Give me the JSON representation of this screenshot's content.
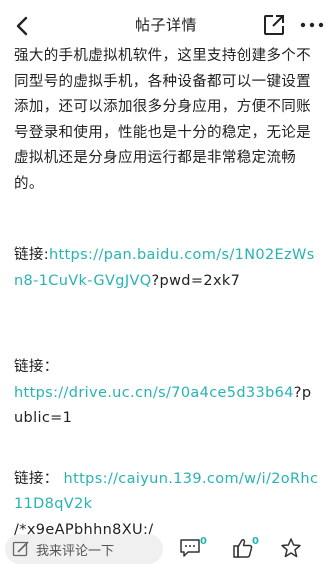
{
  "header": {
    "title": "帖子详情"
  },
  "post": {
    "body": "强大的手机虚拟机软件，这里支持创建多个不同型号的虚拟手机，各种设备都可以一键设置添加，还可以添加很多分身应用，方便不同账号登录和使用，性能也是十分的稳定，无论是虚拟机还是分身应用运行都是非常稳定流畅的。",
    "links": [
      {
        "prefix": "链接:",
        "url": "https://pan.baidu.com/s/1N02EzWsn8-1CuVk-GVgJVQ",
        "suffix": "?pwd=2xk7"
      },
      {
        "prefix": "链接：",
        "url": "https://drive.uc.cn/s/70a4ce5d33b64",
        "suffix": "?public=1"
      },
      {
        "prefix": "链接：",
        "url": "https://caiyun.139.com/w/i/2oRhc11D8qV2k",
        "suffix": "/*x9eAPbhhn8XU:/"
      }
    ]
  },
  "bottom_bar": {
    "comment_placeholder": "我来评论一下",
    "comment_count": "0",
    "like_count": "0"
  },
  "colors": {
    "link": "#28b3b3",
    "text": "#222222",
    "comment_box_bg": "#f0f0f0"
  },
  "icons": [
    "back-arrow-icon",
    "share-icon",
    "more-icon",
    "pencil-icon",
    "comment-icon",
    "thumbs-up-icon",
    "star-icon"
  ]
}
